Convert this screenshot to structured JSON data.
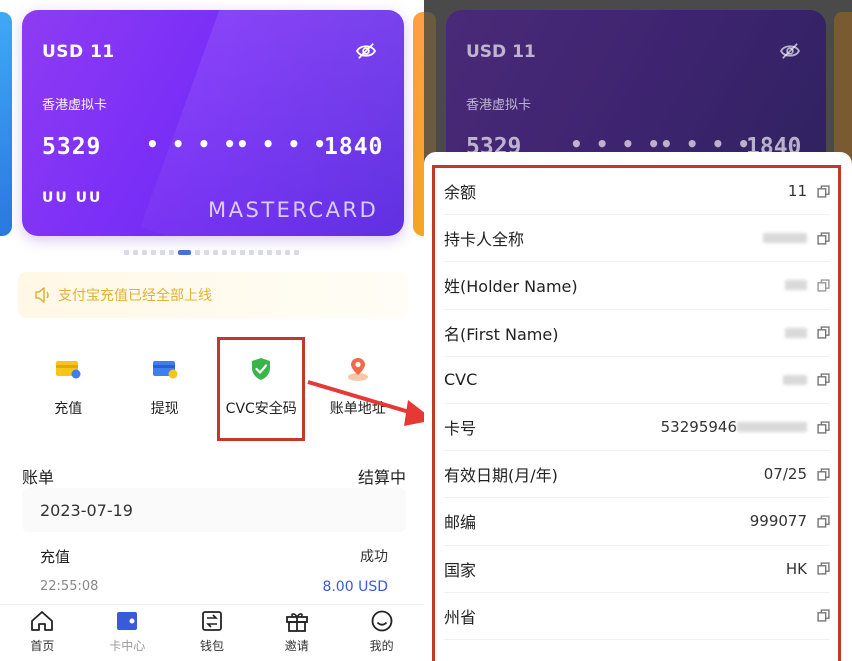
{
  "card": {
    "balance": "USD 11",
    "type": "香港虚拟卡",
    "num_start": "5329",
    "dots": "• • • •",
    "num_end": "1840",
    "holder": "UU UU",
    "brand": "MASTERCARD",
    "colors": {
      "card_start": "#8e3cf2",
      "card_end": "#5b2be0"
    }
  },
  "notice": {
    "text": "支付宝充值已经全部上线",
    "icon": "speaker-icon",
    "color": "#e0b235"
  },
  "actions": [
    {
      "label": "充值",
      "icon": "topup-card-icon"
    },
    {
      "label": "提现",
      "icon": "withdraw-wallet-icon"
    },
    {
      "label": "CVC安全码",
      "icon": "shield-check-icon"
    },
    {
      "label": "账单地址",
      "icon": "location-pin-icon"
    }
  ],
  "bill": {
    "title": "账单",
    "status_header": "结算中",
    "date": "2023-07-19",
    "row": {
      "title": "充值",
      "status": "成功",
      "time": "22:55:08",
      "amount": "8.00 USD"
    }
  },
  "tabs": [
    {
      "label": "首页",
      "icon": "home-icon"
    },
    {
      "label": "卡中心",
      "icon": "card-center-icon"
    },
    {
      "label": "钱包",
      "icon": "wallet-icon"
    },
    {
      "label": "邀请",
      "icon": "gift-icon"
    },
    {
      "label": "我的",
      "icon": "profile-icon"
    }
  ],
  "details": {
    "rows": [
      {
        "label": "余额",
        "value": "11"
      },
      {
        "label": "持卡人全称",
        "value": ""
      },
      {
        "label": "姓(Holder Name)",
        "value": ""
      },
      {
        "label": "名(First Name)",
        "value": ""
      },
      {
        "label": "CVC",
        "value": ""
      },
      {
        "label": "卡号",
        "value": "53295946"
      },
      {
        "label": "有效日期(月/年)",
        "value": "07/25"
      },
      {
        "label": "邮编",
        "value": "999077"
      },
      {
        "label": "国家",
        "value": "HK"
      },
      {
        "label": "州省",
        "value": ""
      }
    ]
  },
  "highlight_color": "#c0392b"
}
